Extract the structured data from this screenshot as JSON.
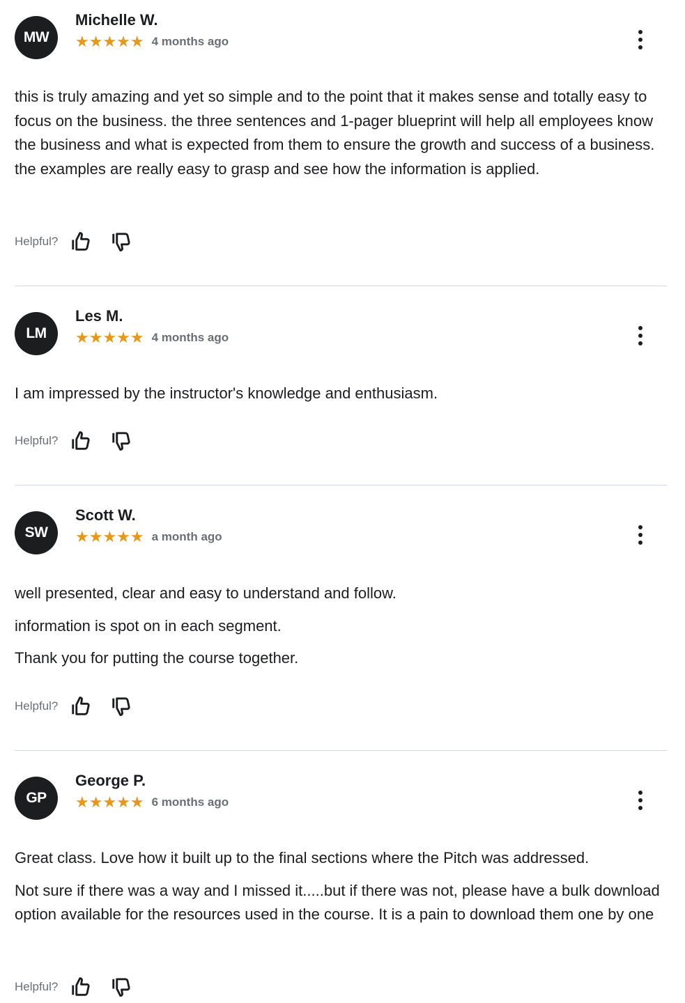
{
  "rating_color": "#e59819",
  "reviews": [
    {
      "initials": "MW",
      "name": "Michelle W.",
      "rating": 5,
      "stars": "★★★★★",
      "date": "4 months ago",
      "paragraphs": [
        "this is truly amazing and yet so simple and to the point that it makes sense and totally easy to focus on the business. the three sentences and 1-pager blueprint will help all employees know the business and what is expected from them to ensure the growth and success of a business. the examples are really easy to grasp and see how the information is applied."
      ],
      "helpful_label": "Helpful?"
    },
    {
      "initials": "LM",
      "name": "Les M.",
      "rating": 5,
      "stars": "★★★★★",
      "date": "4 months ago",
      "paragraphs": [
        "I am impressed by the instructor's knowledge and enthusiasm."
      ],
      "helpful_label": "Helpful?"
    },
    {
      "initials": "SW",
      "name": "Scott W.",
      "rating": 5,
      "stars": "★★★★★",
      "date": "a month ago",
      "paragraphs": [
        "well presented, clear and easy to understand and follow.",
        "information is spot on in each segment.",
        "Thank you for putting the course together."
      ],
      "helpful_label": "Helpful?"
    },
    {
      "initials": "GP",
      "name": "George P.",
      "rating": 5,
      "stars": "★★★★★",
      "date": "6 months ago",
      "paragraphs": [
        "Great class. Love how it built up to the final sections where the Pitch was addressed.",
        "Not sure if there was a way and I missed it.....but if there was not, please have a bulk download option available for the resources used in the course. It is a pain to download them one by one"
      ],
      "helpful_label": "Helpful?"
    }
  ]
}
